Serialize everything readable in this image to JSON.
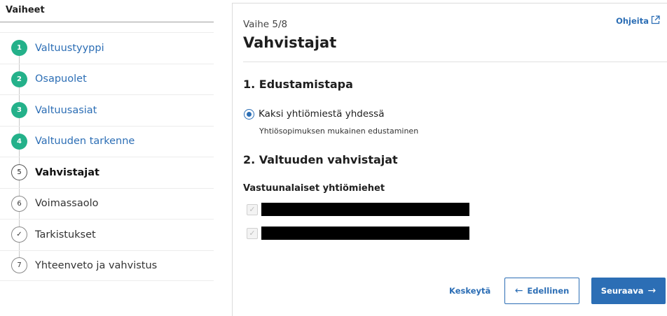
{
  "sidebar": {
    "title": "Vaiheet",
    "steps": [
      {
        "marker": "1",
        "label": "Valtuustyyppi",
        "state": "done"
      },
      {
        "marker": "2",
        "label": "Osapuolet",
        "state": "done"
      },
      {
        "marker": "3",
        "label": "Valtuusasiat",
        "state": "done"
      },
      {
        "marker": "4",
        "label": "Valtuuden tarkenne",
        "state": "done"
      },
      {
        "marker": "5",
        "label": "Vahvistajat",
        "state": "current"
      },
      {
        "marker": "6",
        "label": "Voimassaolo",
        "state": "todo"
      },
      {
        "marker": "✓",
        "label": "Tarkistukset",
        "state": "todo"
      },
      {
        "marker": "7",
        "label": "Yhteenveto ja vahvistus",
        "state": "todo"
      }
    ]
  },
  "main": {
    "phase": "Vaihe 5/8",
    "help_label": "Ohjeita",
    "help_icon": "external-link-icon",
    "title": "Vahvistajat",
    "section1": {
      "heading": "1. Edustamistapa",
      "option_label": "Kaksi yhtiömiestä yhdessä",
      "option_description": "Yhtiösopimuksen mukainen edustaminen",
      "selected": true
    },
    "section2": {
      "heading": "2. Valtuuden vahvistajat",
      "group_label": "Vastuunalaiset yhtiömiehet",
      "persons": [
        {
          "checked": true,
          "disabled": true
        },
        {
          "checked": true,
          "disabled": true
        }
      ]
    }
  },
  "footer": {
    "cancel_label": "Keskeytä",
    "prev_label": "Edellinen",
    "next_label": "Seuraava"
  },
  "colors": {
    "accent": "#2c6eb5",
    "step_done": "#24b18a"
  }
}
